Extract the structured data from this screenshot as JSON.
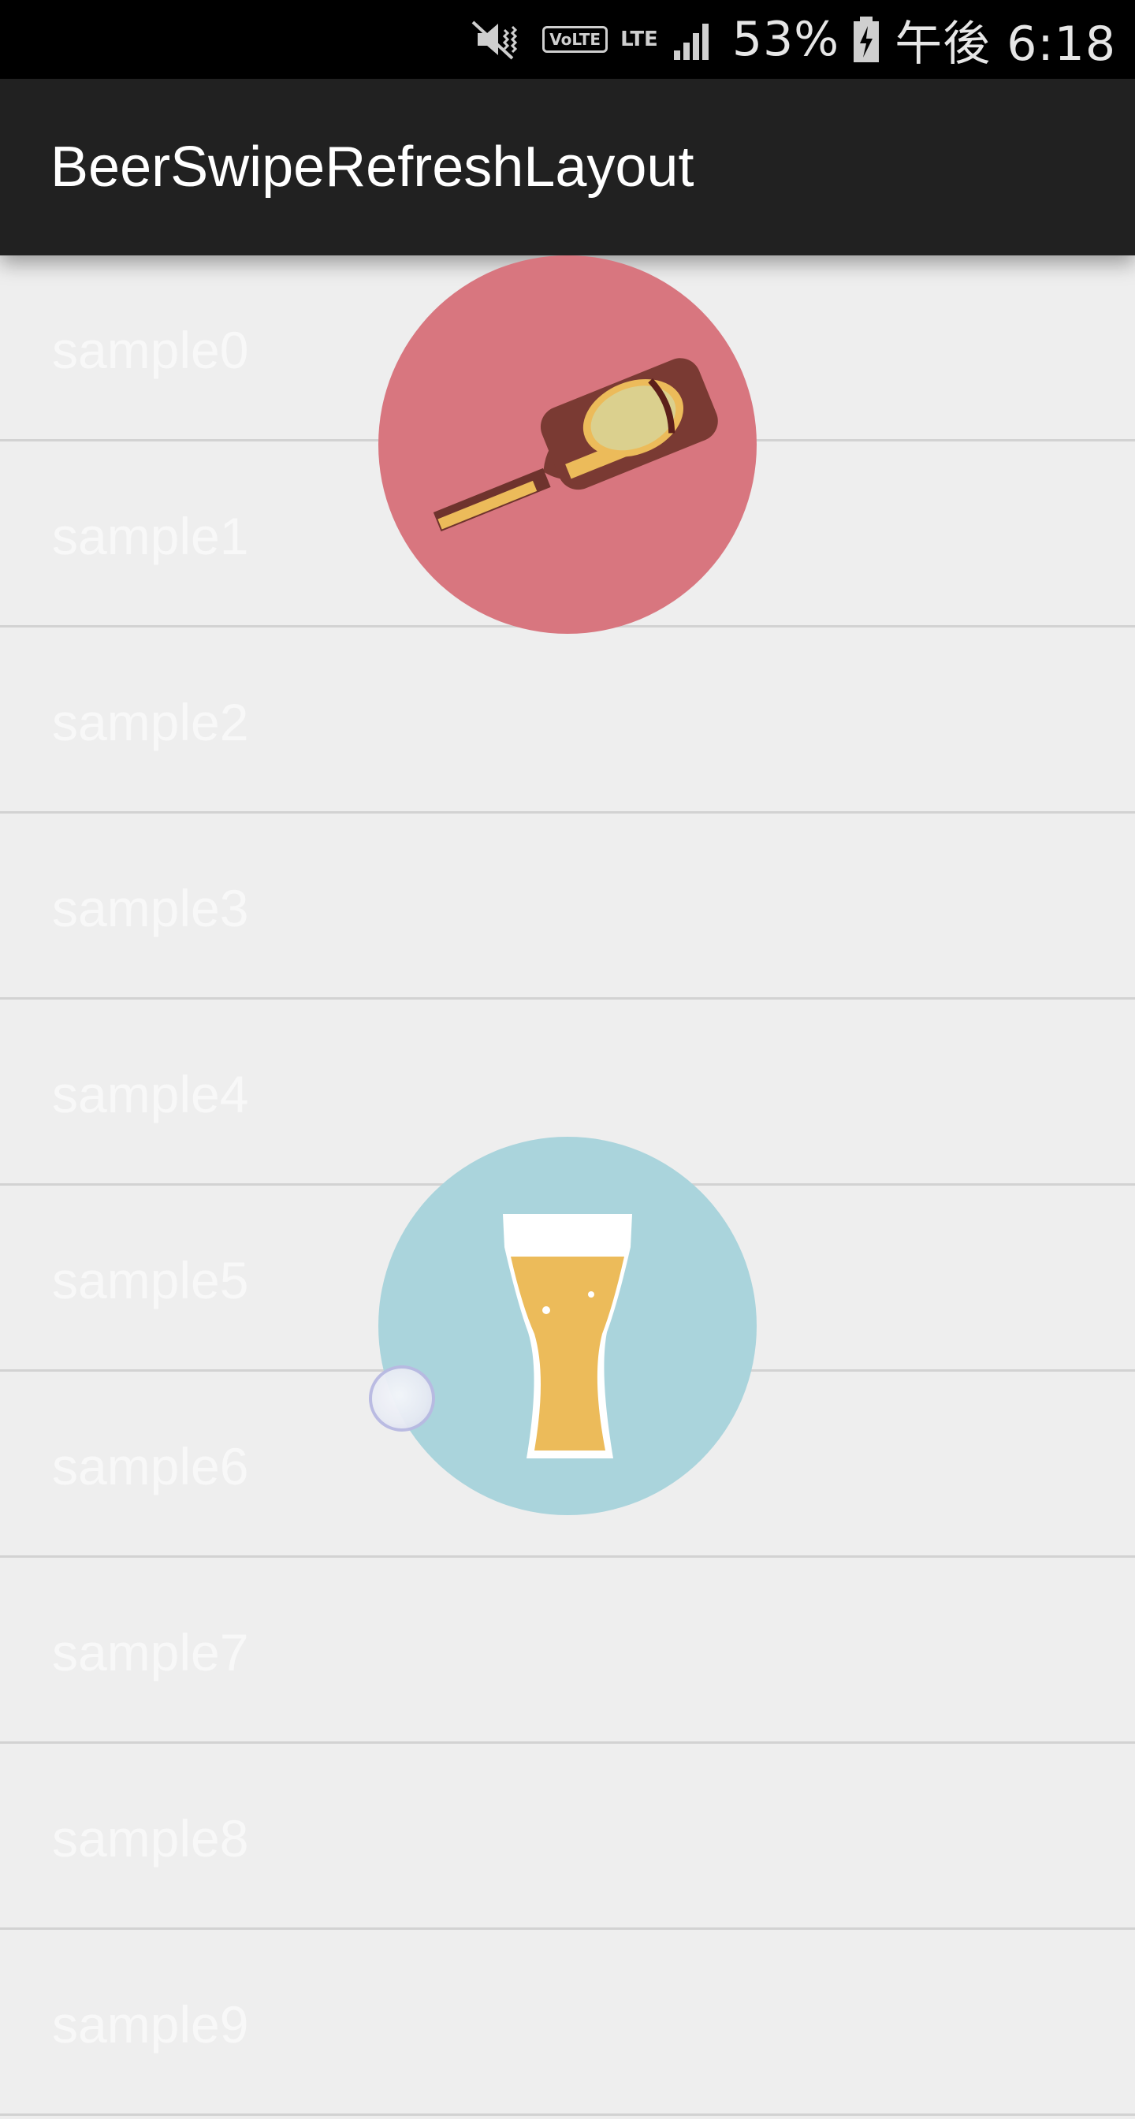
{
  "status_bar": {
    "battery": "53%",
    "time": "午後 6:18",
    "icons": [
      "mute-icon",
      "volte-icon",
      "lte-icon",
      "signal-icon",
      "battery-charging-icon"
    ],
    "volte_label": "VoLTE",
    "lte_label": "LTE"
  },
  "app_bar": {
    "title": "BeerSwipeRefreshLayout"
  },
  "list": {
    "items": [
      {
        "label": "sample0"
      },
      {
        "label": "sample1"
      },
      {
        "label": "sample2"
      },
      {
        "label": "sample3"
      },
      {
        "label": "sample4"
      },
      {
        "label": "sample5"
      },
      {
        "label": "sample6"
      },
      {
        "label": "sample7"
      },
      {
        "label": "sample8"
      },
      {
        "label": "sample9"
      }
    ]
  },
  "refresh_indicator": {
    "icon": "beer-bottle-icon",
    "color": "#d8767f"
  },
  "beer_indicator": {
    "icon": "beer-glass-icon",
    "color": "#aad4dc",
    "beer_color": "#ecbb5a"
  },
  "colors": {
    "status_bar": "#000000",
    "app_bar": "#212121",
    "background": "#eeeeee",
    "divider": "#d2d2d2"
  }
}
